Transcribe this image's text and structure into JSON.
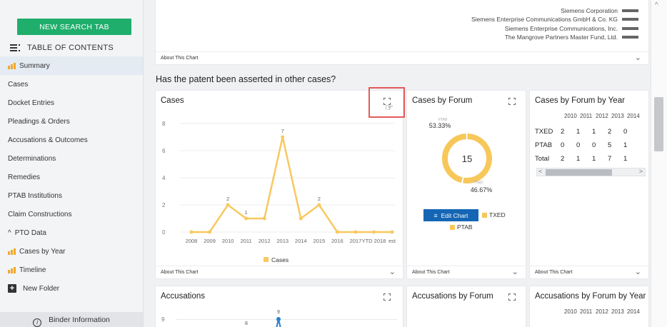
{
  "sidebar": {
    "new_tab_label": "NEW SEARCH TAB",
    "toc_label": "TABLE OF CONTENTS",
    "items": [
      {
        "label": "Summary"
      },
      {
        "label": "Cases"
      },
      {
        "label": "Docket Entries"
      },
      {
        "label": "Pleadings & Orders"
      },
      {
        "label": "Accusations & Outcomes"
      },
      {
        "label": "Determinations"
      },
      {
        "label": "Remedies"
      },
      {
        "label": "PTAB Institutions"
      },
      {
        "label": "Claim Constructions"
      },
      {
        "label": "PTO Data"
      },
      {
        "label": "Cases by Year"
      },
      {
        "label": "Timeline"
      },
      {
        "label": "New Folder"
      }
    ],
    "binder_label": "Binder Information"
  },
  "top_card": {
    "legend": [
      "Siemens Corporation",
      "Siemens Enterprise Communications GmbH & Co. KG",
      "Siemens Enterprise Communications, Inc.",
      "The Mangrove Partners Master Fund, Ltd."
    ],
    "footer": "About This Chart"
  },
  "section_title": "Has the patent been asserted in other cases?",
  "cases_card": {
    "title": "Cases",
    "footer": "About This Chart",
    "legend": "Cases"
  },
  "forum_card": {
    "title": "Cases by Forum",
    "total": "15",
    "ptab_pct": "53.33%",
    "txed_pct": "46.67%",
    "ptab_label": "PTAB",
    "txed_label": "TXED",
    "edit_label": "Edit Chart",
    "footer": "About This Chart"
  },
  "forum_year_card": {
    "title": "Cases by Forum by Year",
    "years": [
      "2010",
      "2011",
      "2012",
      "2013",
      "2014"
    ],
    "rows": [
      {
        "label": "TXED",
        "values": [
          "2",
          "1",
          "1",
          "2",
          "0"
        ]
      },
      {
        "label": "PTAB",
        "values": [
          "0",
          "0",
          "0",
          "5",
          "1"
        ]
      },
      {
        "label": "Total",
        "values": [
          "2",
          "1",
          "1",
          "7",
          "1"
        ]
      }
    ],
    "footer": "About This Chart"
  },
  "accusations_card": {
    "title": "Accusations",
    "y_top": "9",
    "labels": [
      "9",
      "8"
    ]
  },
  "acc_forum_card": {
    "title": "Accusations by Forum"
  },
  "acc_forum_year_card": {
    "title": "Accusations by Forum by Year",
    "years": [
      "2010",
      "2011",
      "2012",
      "2013",
      "2014"
    ]
  },
  "colors": {
    "accent_green": "#1fae6b",
    "series": "#f9c85f",
    "ptab": "#f7c75a",
    "txed": "#f7c75a",
    "highlight": "#e25a5a",
    "edit_btn": "#1466b5"
  },
  "chart_data": [
    {
      "type": "line",
      "title": "Cases",
      "categories": [
        "2008",
        "2009",
        "2010",
        "2011",
        "2012",
        "2013",
        "2014",
        "2015",
        "2016",
        "2017",
        "YTD 2018",
        "est"
      ],
      "series": [
        {
          "name": "Cases",
          "values": [
            0,
            0,
            2,
            1,
            1,
            7,
            1,
            2,
            0,
            0,
            0,
            0
          ]
        }
      ],
      "data_labels": [
        "",
        "",
        "2",
        "1",
        "",
        "7",
        "",
        "2",
        "",
        "",
        "",
        ""
      ],
      "yticks": [
        0,
        2,
        4,
        6,
        8
      ],
      "ylim": [
        0,
        8
      ],
      "legend": "bottom"
    },
    {
      "type": "pie",
      "title": "Cases by Forum",
      "slices": [
        {
          "name": "PTAB",
          "value": 53.33
        },
        {
          "name": "TXED",
          "value": 46.67
        }
      ],
      "center_label": "15"
    }
  ]
}
